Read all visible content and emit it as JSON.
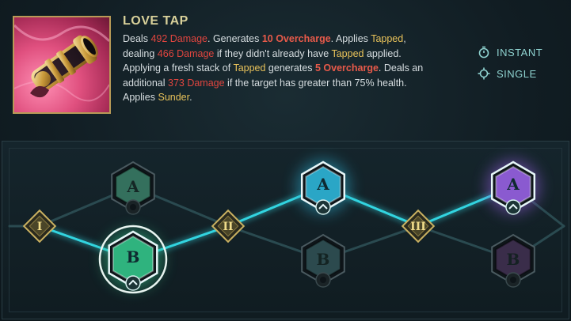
{
  "ability": {
    "name": "LOVE TAP",
    "icon": "cannon-icon",
    "description": [
      {
        "t": "Deals ",
        "c": "txt"
      },
      {
        "t": "492 Damage",
        "c": "dmg"
      },
      {
        "t": ". Generates ",
        "c": "txt"
      },
      {
        "t": "10 Overcharge",
        "c": "oc"
      },
      {
        "t": ". Applies ",
        "c": "txt"
      },
      {
        "t": "Tapped",
        "c": "kw"
      },
      {
        "t": ", dealing ",
        "c": "txt"
      },
      {
        "t": "466 Damage",
        "c": "dmg"
      },
      {
        "t": " if they didn't already have ",
        "c": "txt"
      },
      {
        "t": "Tapped",
        "c": "kw"
      },
      {
        "t": " applied. Applying a fresh stack of ",
        "c": "txt"
      },
      {
        "t": "Tapped",
        "c": "kw"
      },
      {
        "t": " generates ",
        "c": "txt"
      },
      {
        "t": "5 Overcharge",
        "c": "oc"
      },
      {
        "t": ". Deals an additional ",
        "c": "txt"
      },
      {
        "t": "373 Damage",
        "c": "dmg"
      },
      {
        "t": " if the target has greater than 75% health. Applies ",
        "c": "txt"
      },
      {
        "t": "Sunder",
        "c": "kw"
      },
      {
        "t": ".",
        "c": "txt"
      }
    ]
  },
  "tags": [
    {
      "label": "INSTANT",
      "icon": "stopwatch-icon"
    },
    {
      "label": "SINGLE",
      "icon": "crosshair-icon"
    }
  ],
  "talent_tree": {
    "ranks": [
      "I",
      "II",
      "III"
    ],
    "tiers": [
      {
        "rank": "I",
        "options": [
          {
            "letter": "A",
            "state": "locked",
            "color": "#34705d"
          },
          {
            "letter": "B",
            "state": "selected",
            "color": "#2fb37e"
          }
        ]
      },
      {
        "rank": "II",
        "options": [
          {
            "letter": "A",
            "state": "selected",
            "color": "#2aa6c6"
          },
          {
            "letter": "B",
            "state": "locked",
            "color": "#2c4a4e"
          }
        ]
      },
      {
        "rank": "III",
        "options": [
          {
            "letter": "A",
            "state": "selected",
            "color": "#8a5ad0"
          },
          {
            "letter": "B",
            "state": "locked",
            "color": "#3a2d4a"
          }
        ]
      }
    ],
    "colors": {
      "path_active": "#33d4e0",
      "path_inactive": "#2a4a50",
      "rank_gold": "#c9b060"
    }
  }
}
